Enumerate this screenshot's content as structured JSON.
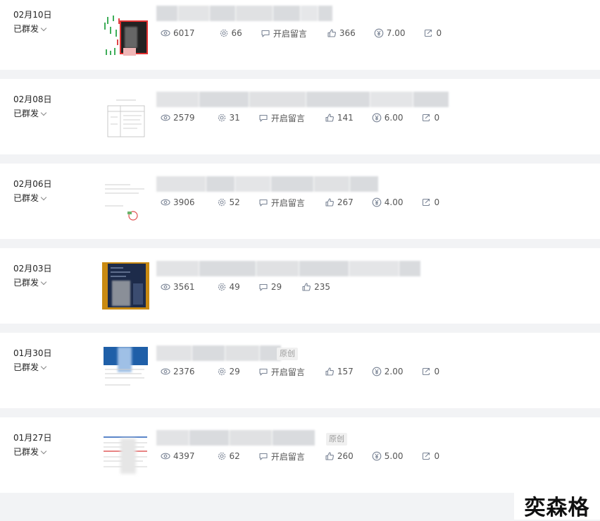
{
  "articles": [
    {
      "date": "02月10日",
      "status": "已群发",
      "views": "6017",
      "shares": "66",
      "comment": "开启留言",
      "likes": "366",
      "reward": "7.00",
      "forwards": "0",
      "badge": ""
    },
    {
      "date": "02月08日",
      "status": "已群发",
      "views": "2579",
      "shares": "31",
      "comment": "开启留言",
      "likes": "141",
      "reward": "6.00",
      "forwards": "0",
      "badge": ""
    },
    {
      "date": "02月06日",
      "status": "已群发",
      "views": "3906",
      "shares": "52",
      "comment": "开启留言",
      "likes": "267",
      "reward": "4.00",
      "forwards": "0",
      "badge": ""
    },
    {
      "date": "02月03日",
      "status": "已群发",
      "views": "3561",
      "shares": "49",
      "comments": "29",
      "likes": "235",
      "badge": ""
    },
    {
      "date": "01月30日",
      "status": "已群发",
      "views": "2376",
      "shares": "29",
      "comment": "开启留言",
      "likes": "157",
      "reward": "2.00",
      "forwards": "0",
      "badge": "原创"
    },
    {
      "date": "01月27日",
      "status": "已群发",
      "views": "4397",
      "shares": "62",
      "comment": "开启留言",
      "likes": "260",
      "reward": "5.00",
      "forwards": "0",
      "badge": "原创"
    }
  ],
  "watermark": "奕森格",
  "colors": {
    "background": "#f2f3f5",
    "card": "#ffffff",
    "icon": "#7b8596"
  }
}
